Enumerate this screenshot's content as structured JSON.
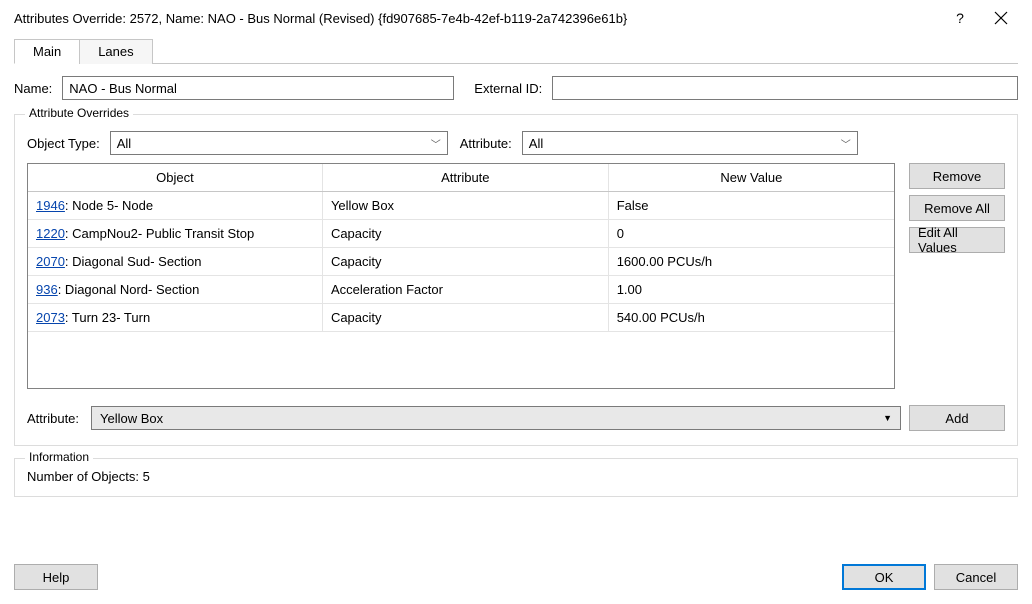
{
  "title": "Attributes Override: 2572, Name: NAO - Bus Normal (Revised)  {fd907685-7e4b-42ef-b119-2a742396e61b}",
  "tabs": {
    "main": "Main",
    "lanes": "Lanes"
  },
  "labels": {
    "name": "Name:",
    "external_id": "External ID:",
    "object_type": "Object Type:",
    "attribute_filter": "Attribute:",
    "attribute_select": "Attribute:",
    "attr_overrides_legend": "Attribute Overrides",
    "information_legend": "Information",
    "num_objects_label": "Number of Objects:"
  },
  "inputs": {
    "name_value": "NAO - Bus Normal",
    "external_id_value": ""
  },
  "filters": {
    "object_type_value": "All",
    "attribute_value": "All"
  },
  "columns": {
    "object": "Object",
    "attribute": "Attribute",
    "new_value": "New Value"
  },
  "rows": [
    {
      "id": "1946",
      "obj": "Node 5- Node",
      "attr": "Yellow Box",
      "val": "False"
    },
    {
      "id": "1220",
      "obj": "CampNou2- Public Transit Stop",
      "attr": "Capacity",
      "val": "0"
    },
    {
      "id": "2070",
      "obj": "Diagonal Sud- Section",
      "attr": "Capacity",
      "val": "1600.00 PCUs/h"
    },
    {
      "id": "936",
      "obj": "Diagonal Nord- Section",
      "attr": "Acceleration Factor",
      "val": "1.00"
    },
    {
      "id": "2073",
      "obj": "Turn 23- Turn",
      "attr": "Capacity",
      "val": "540.00 PCUs/h"
    }
  ],
  "attr_select_value": "Yellow Box",
  "info": {
    "num_objects": "5"
  },
  "buttons": {
    "remove": "Remove",
    "remove_all": "Remove All",
    "edit_all": "Edit All Values",
    "add": "Add",
    "help": "Help",
    "ok": "OK",
    "cancel": "Cancel"
  }
}
